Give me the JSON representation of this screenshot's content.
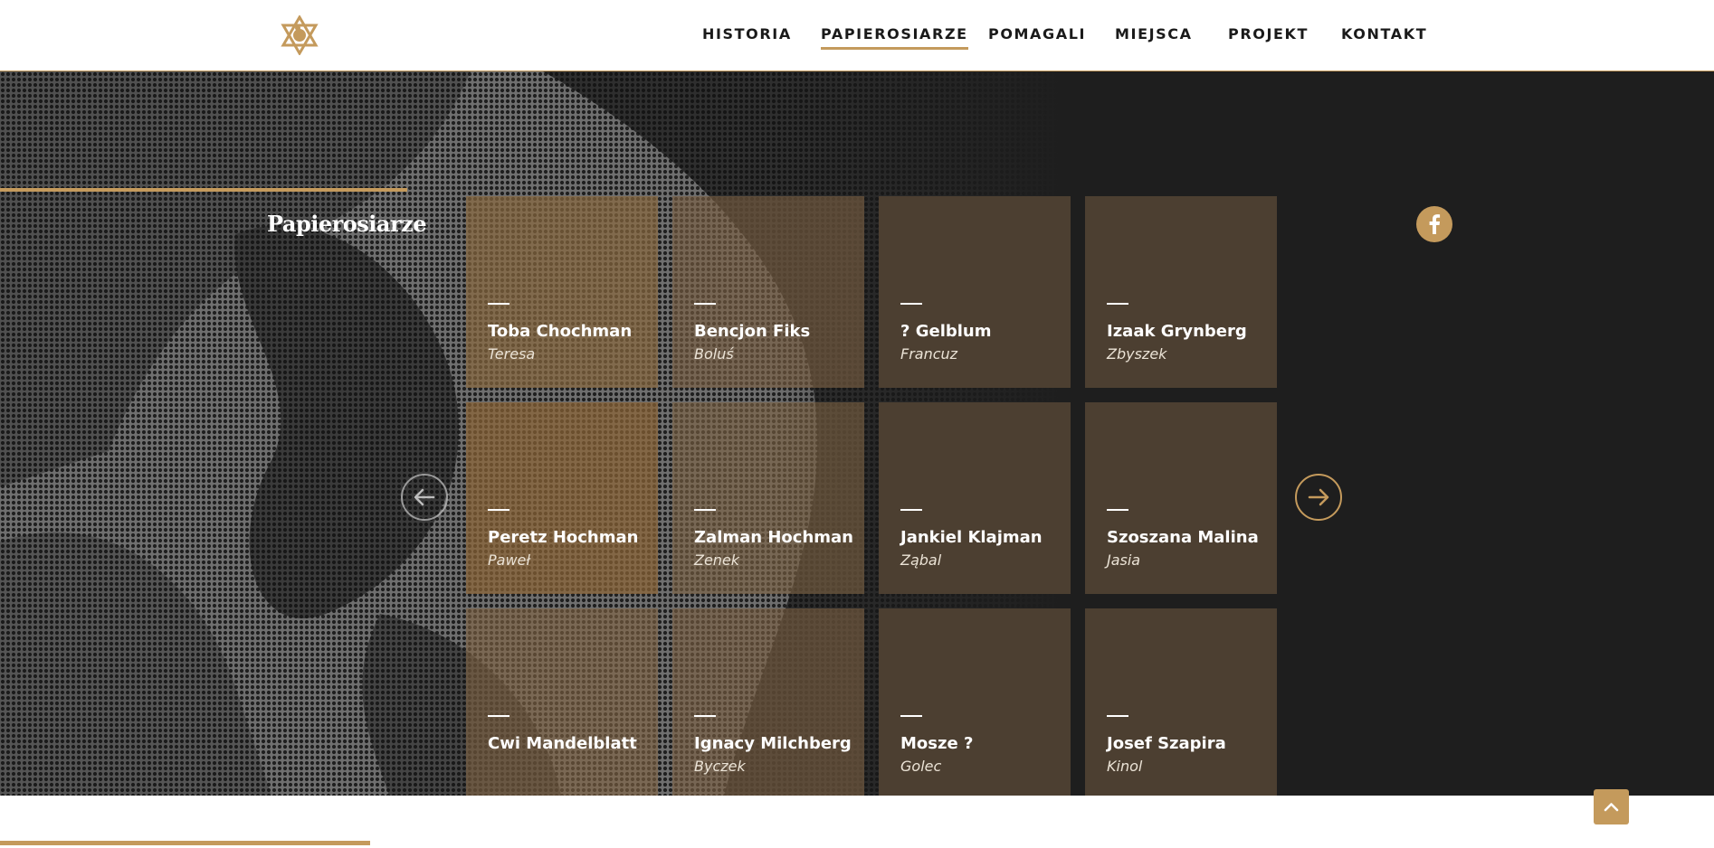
{
  "colors": {
    "accent": "#c49a5c",
    "dark": "#1e1e1e",
    "card": "#4c3f31"
  },
  "header": {
    "logo_icon": "star-of-david-logo-icon",
    "nav": [
      {
        "label": "HISTORIA",
        "active": false
      },
      {
        "label": "PAPIEROSIARZE",
        "active": true
      },
      {
        "label": "POMAGALI",
        "active": false
      },
      {
        "label": "MIEJSCA",
        "active": false
      },
      {
        "label": "PROJEKT",
        "active": false
      },
      {
        "label": "KONTAKT",
        "active": false
      }
    ]
  },
  "section": {
    "title": "Papierosiarze"
  },
  "social": {
    "facebook_icon": "facebook-icon"
  },
  "carousel": {
    "prev_icon": "arrow-left-icon",
    "next_icon": "arrow-right-icon",
    "people": [
      {
        "name": "Toba Chochman",
        "alias": "Teresa"
      },
      {
        "name": "Bencjon Fiks",
        "alias": "Boluś"
      },
      {
        "name": "? Gelblum",
        "alias": "Francuz"
      },
      {
        "name": "Izaak Grynberg",
        "alias": "Zbyszek"
      },
      {
        "name": "Peretz Hochman",
        "alias": "Paweł"
      },
      {
        "name": "Zalman Hochman",
        "alias": "Zenek"
      },
      {
        "name": "Jankiel Klajman",
        "alias": "Ząbal"
      },
      {
        "name": "Szoszana Malina",
        "alias": "Jasia"
      },
      {
        "name": "Cwi Mandelblatt",
        "alias": ""
      },
      {
        "name": "Ignacy Milchberg",
        "alias": "Byczek"
      },
      {
        "name": "Mosze ?",
        "alias": "Golec"
      },
      {
        "name": "Josef Szapira",
        "alias": "Kinol"
      }
    ]
  },
  "back_to_top": {
    "icon": "chevron-up-icon"
  }
}
